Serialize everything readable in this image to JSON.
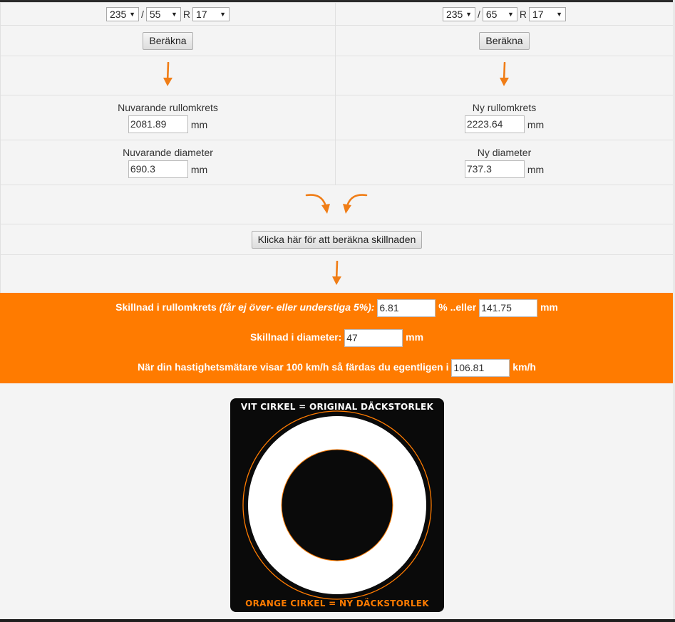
{
  "left": {
    "width_value": "235",
    "separator": "/",
    "profile_value": "55",
    "rim_prefix": "R",
    "rim_value": "17",
    "calc_button": "Beräkna",
    "circumference_label": "Nuvarande rullomkrets",
    "circumference_value": "2081.89",
    "diameter_label": "Nuvarande diameter",
    "diameter_value": "690.3",
    "unit": "mm"
  },
  "right": {
    "width_value": "235",
    "separator": "/",
    "profile_value": "65",
    "rim_prefix": "R",
    "rim_value": "17",
    "calc_button": "Beräkna",
    "circumference_label": "Ny rullomkrets",
    "circumference_value": "2223.64",
    "diameter_label": "Ny diameter",
    "diameter_value": "737.3",
    "unit": "mm"
  },
  "diff_button": "Klicka här för att beräkna skillnaden",
  "results": {
    "circ_label": "Skillnad i rullomkrets",
    "circ_note": "(får ej över- eller understiga 5%):",
    "circ_percent_value": "6.81",
    "circ_percent_suffix": "% ..eller",
    "circ_mm_value": "141.75",
    "circ_mm_unit": "mm",
    "diam_label": "Skillnad i diameter:",
    "diam_value": "47",
    "diam_unit": "mm",
    "speed_label": "När din hastighetsmätare visar 100 km/h så färdas du egentligen i",
    "speed_value": "106.81",
    "speed_unit": "km/h"
  },
  "illustration": {
    "title_top": "VIT CIRKEL = ORIGINAL DÄCKSTORLEK",
    "title_bottom": "ORANGE CIRKEL = NY DÄCKSTORLEK",
    "colors": {
      "background": "#0a0a0a",
      "original": "#ffffff",
      "new": "#ff7b00"
    }
  },
  "colors": {
    "accent": "#ff7b00",
    "arrow": "#f07d16"
  },
  "icons": {
    "arrow": "arrow-down-icon"
  }
}
